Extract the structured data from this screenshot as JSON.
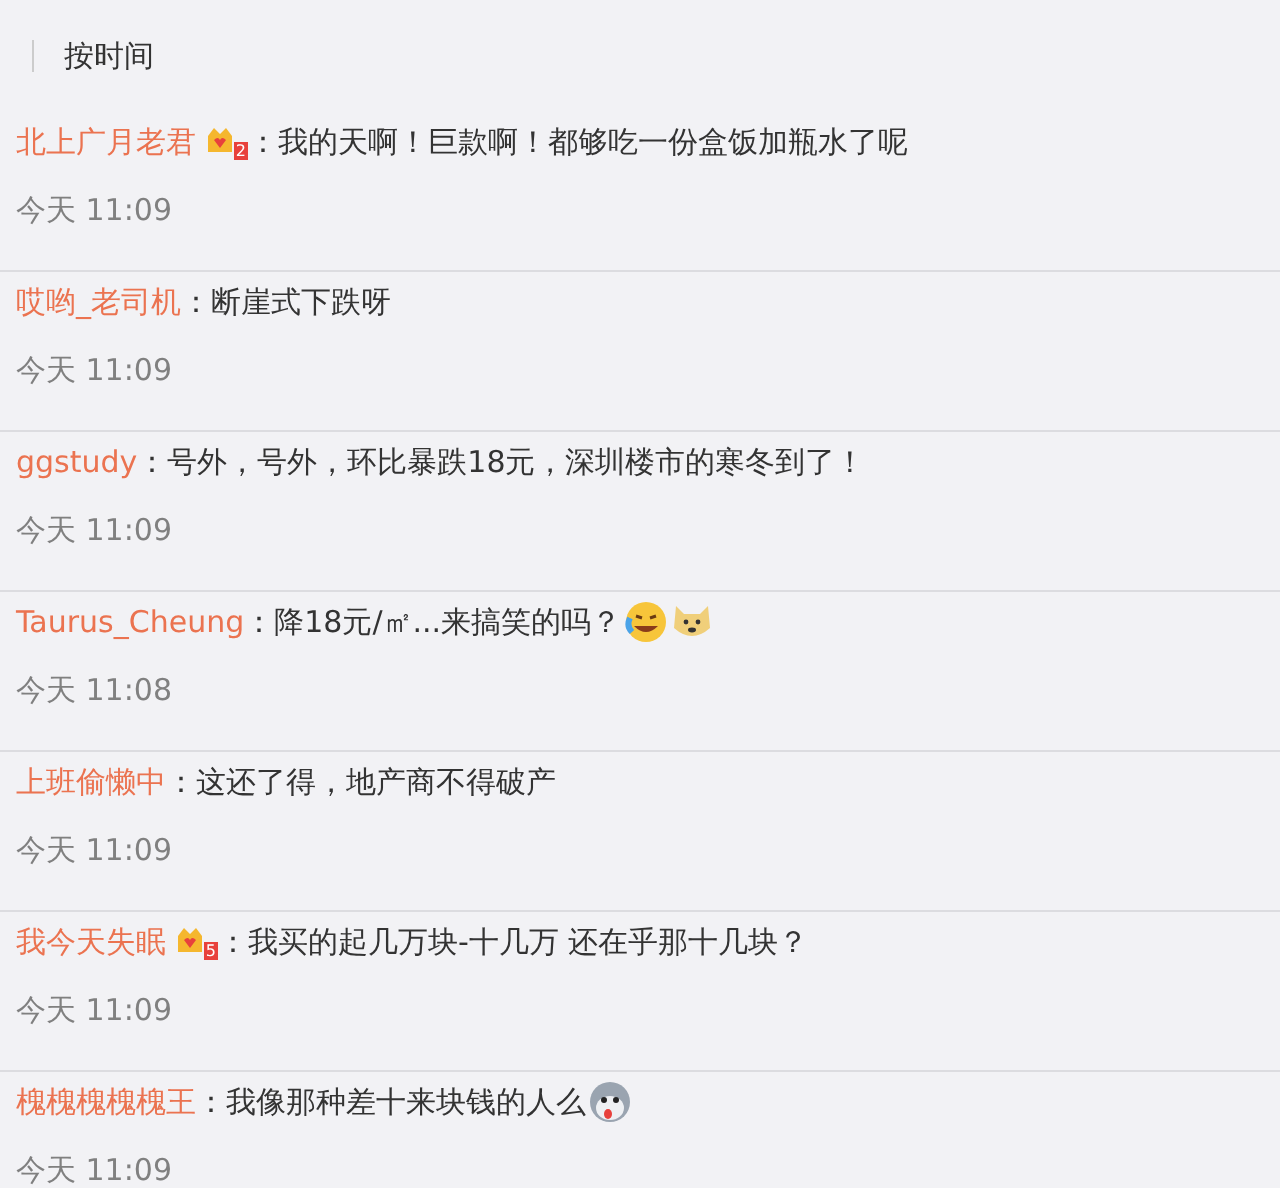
{
  "sort_bar": {
    "options": [
      {
        "label": "按时间",
        "selected": true
      }
    ]
  },
  "comments": [
    {
      "author": "北上广月老君",
      "badge": {
        "level": "2"
      },
      "text": "：我的天啊！巨款啊！都够吃一份盒饭加瓶水了呢",
      "time": "今天 11:09"
    },
    {
      "author": "哎哟_老司机",
      "text": "：断崖式下跌呀",
      "time": "今天 11:09"
    },
    {
      "author": "ggstudy",
      "text": "：号外，号外，环比暴跌18元，深圳楼市的寒冬到了！",
      "time": "今天 11:09"
    },
    {
      "author": "Taurus_Cheung",
      "text": "：降18元/㎡...来搞笑的吗？",
      "emojis": [
        {
          "kind": "laugh-cry"
        },
        {
          "kind": "doge"
        }
      ],
      "time": "今天 11:08"
    },
    {
      "author": "上班偷懒中",
      "text": "：这还了得，地产商不得破产",
      "time": "今天 11:09"
    },
    {
      "author": "我今天失眠",
      "badge": {
        "level": "5"
      },
      "text": "：我买的起几万块-十几万 还在乎那十几块？",
      "time": "今天 11:09"
    },
    {
      "author": "槐槐槐槐槐王",
      "text": "：我像那种差十来块钱的人么",
      "emojis": [
        {
          "kind": "husky"
        }
      ],
      "time": "今天 11:09"
    }
  ]
}
